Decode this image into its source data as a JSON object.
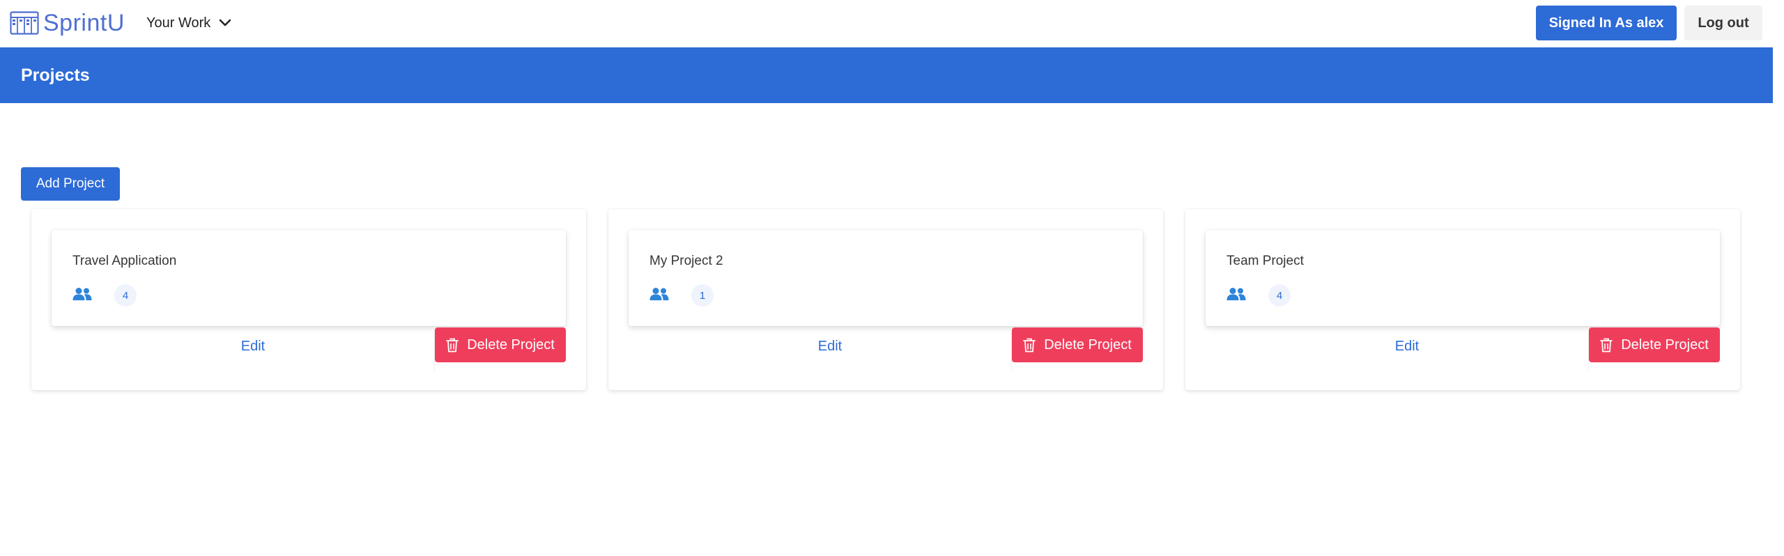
{
  "nav": {
    "brand": "SprintU",
    "dropdown_label": "Your Work",
    "signed_in_label": "Signed In As alex",
    "logout_label": "Log out"
  },
  "header": {
    "title": "Projects"
  },
  "actions": {
    "add_project_label": "Add Project"
  },
  "projects": [
    {
      "name": "Travel Application",
      "members": "4",
      "edit_label": "Edit",
      "delete_label": "Delete Project"
    },
    {
      "name": "My Project 2",
      "members": "1",
      "edit_label": "Edit",
      "delete_label": "Delete Project"
    },
    {
      "name": "Team Project",
      "members": "4",
      "edit_label": "Edit",
      "delete_label": "Delete Project"
    }
  ],
  "colors": {
    "primary": "#2d6bd6",
    "danger": "#ef3e5c",
    "brand": "#4f6fd1",
    "badge_bg": "#eef3fc"
  },
  "icons": {
    "logo": "sprint-board-icon",
    "dropdown": "chevron-down-icon",
    "members": "users-icon",
    "delete": "trash-icon"
  }
}
